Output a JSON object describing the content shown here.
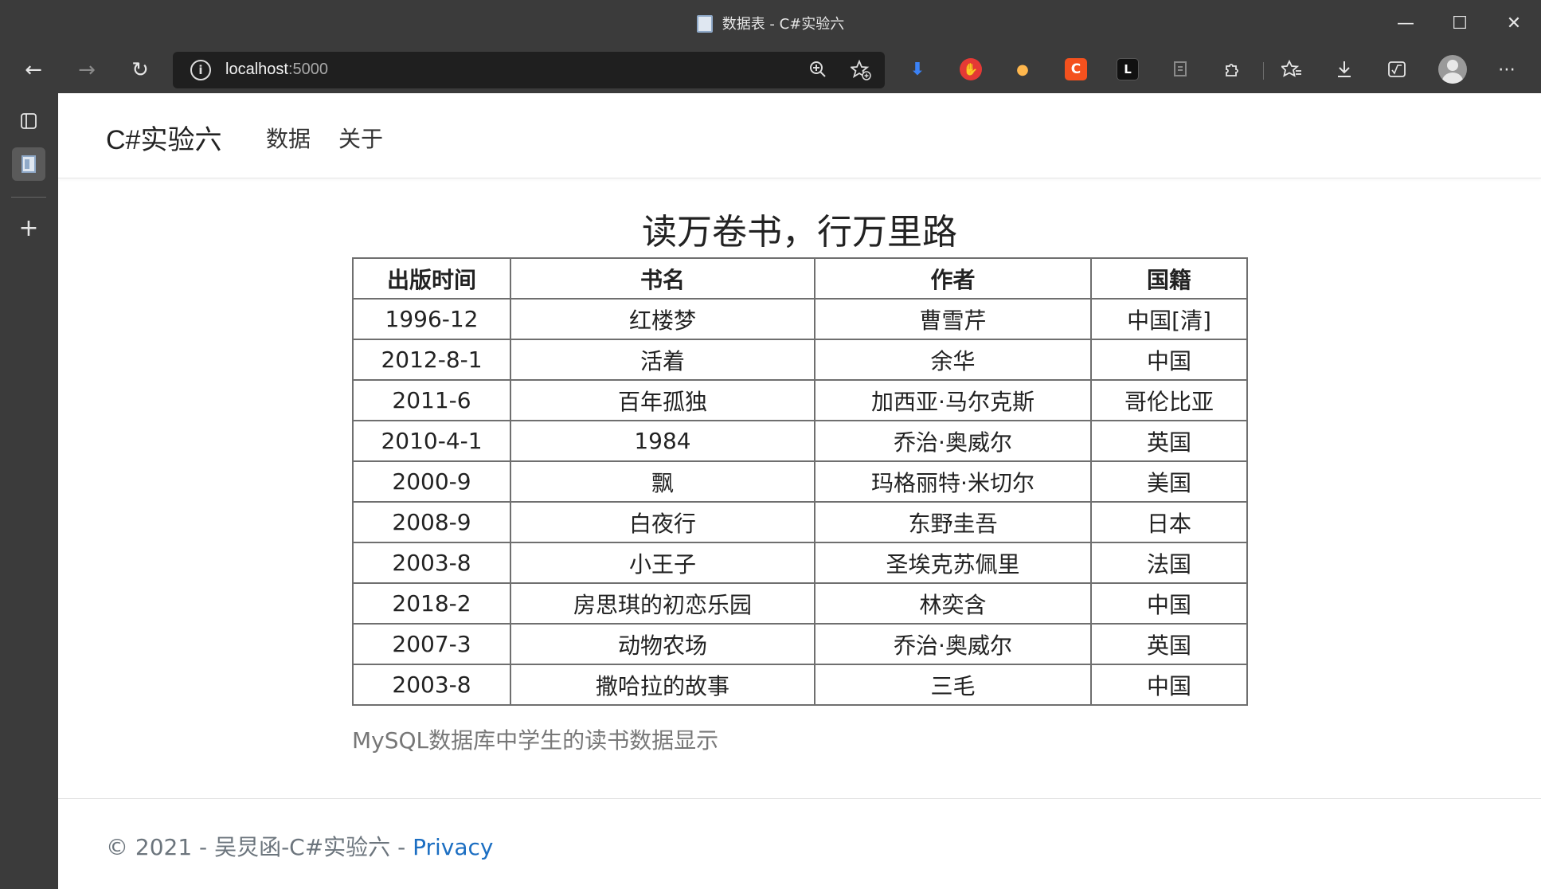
{
  "window": {
    "title": "数据表 - C#实验六",
    "minimize_glyph": "—",
    "maximize_glyph": "☐",
    "close_glyph": "✕"
  },
  "toolbar": {
    "back_glyph": "←",
    "forward_glyph": "→",
    "refresh_glyph": "↻",
    "url_host": "localhost",
    "url_port": ":5000",
    "extensions": [
      {
        "name": "download-arrow-extension-icon",
        "color": "#3b82f6",
        "glyph": "⬇"
      },
      {
        "name": "adblock-extension-icon",
        "color": "#e53935",
        "glyph": "✋"
      },
      {
        "name": "ball-extension-icon",
        "color": "#ffb74d",
        "glyph": "●"
      },
      {
        "name": "c-extension-icon",
        "color": "#f4511e",
        "glyph": "C"
      },
      {
        "name": "l-extension-icon",
        "color": "#111111",
        "glyph": "L"
      }
    ]
  },
  "nav": {
    "brand": "C#实验六",
    "links": [
      "数据",
      "关于"
    ]
  },
  "main": {
    "heading": "读万卷书，行万里路",
    "table": {
      "headers": [
        "出版时间",
        "书名",
        "作者",
        "国籍"
      ],
      "rows": [
        [
          "1996-12",
          "红楼梦",
          "曹雪芹",
          "中国[清]"
        ],
        [
          "2012-8-1",
          "活着",
          "余华",
          "中国"
        ],
        [
          "2011-6",
          "百年孤独",
          "加西亚·马尔克斯",
          "哥伦比亚"
        ],
        [
          "2010-4-1",
          "1984",
          "乔治·奥威尔",
          "英国"
        ],
        [
          "2000-9",
          "飘",
          "玛格丽特·米切尔",
          "美国"
        ],
        [
          "2008-9",
          "白夜行",
          "东野圭吾",
          "日本"
        ],
        [
          "2003-8",
          "小王子",
          "圣埃克苏佩里",
          "法国"
        ],
        [
          "2018-2",
          "房思琪的初恋乐园",
          "林奕含",
          "中国"
        ],
        [
          "2007-3",
          "动物农场",
          "乔治·奥威尔",
          "英国"
        ],
        [
          "2003-8",
          "撒哈拉的故事",
          "三毛",
          "中国"
        ]
      ]
    },
    "note": "MySQL数据库中学生的读书数据显示"
  },
  "footer": {
    "text": "© 2021 - 吴炅函-C#实验六 - ",
    "privacy_link": "Privacy"
  }
}
